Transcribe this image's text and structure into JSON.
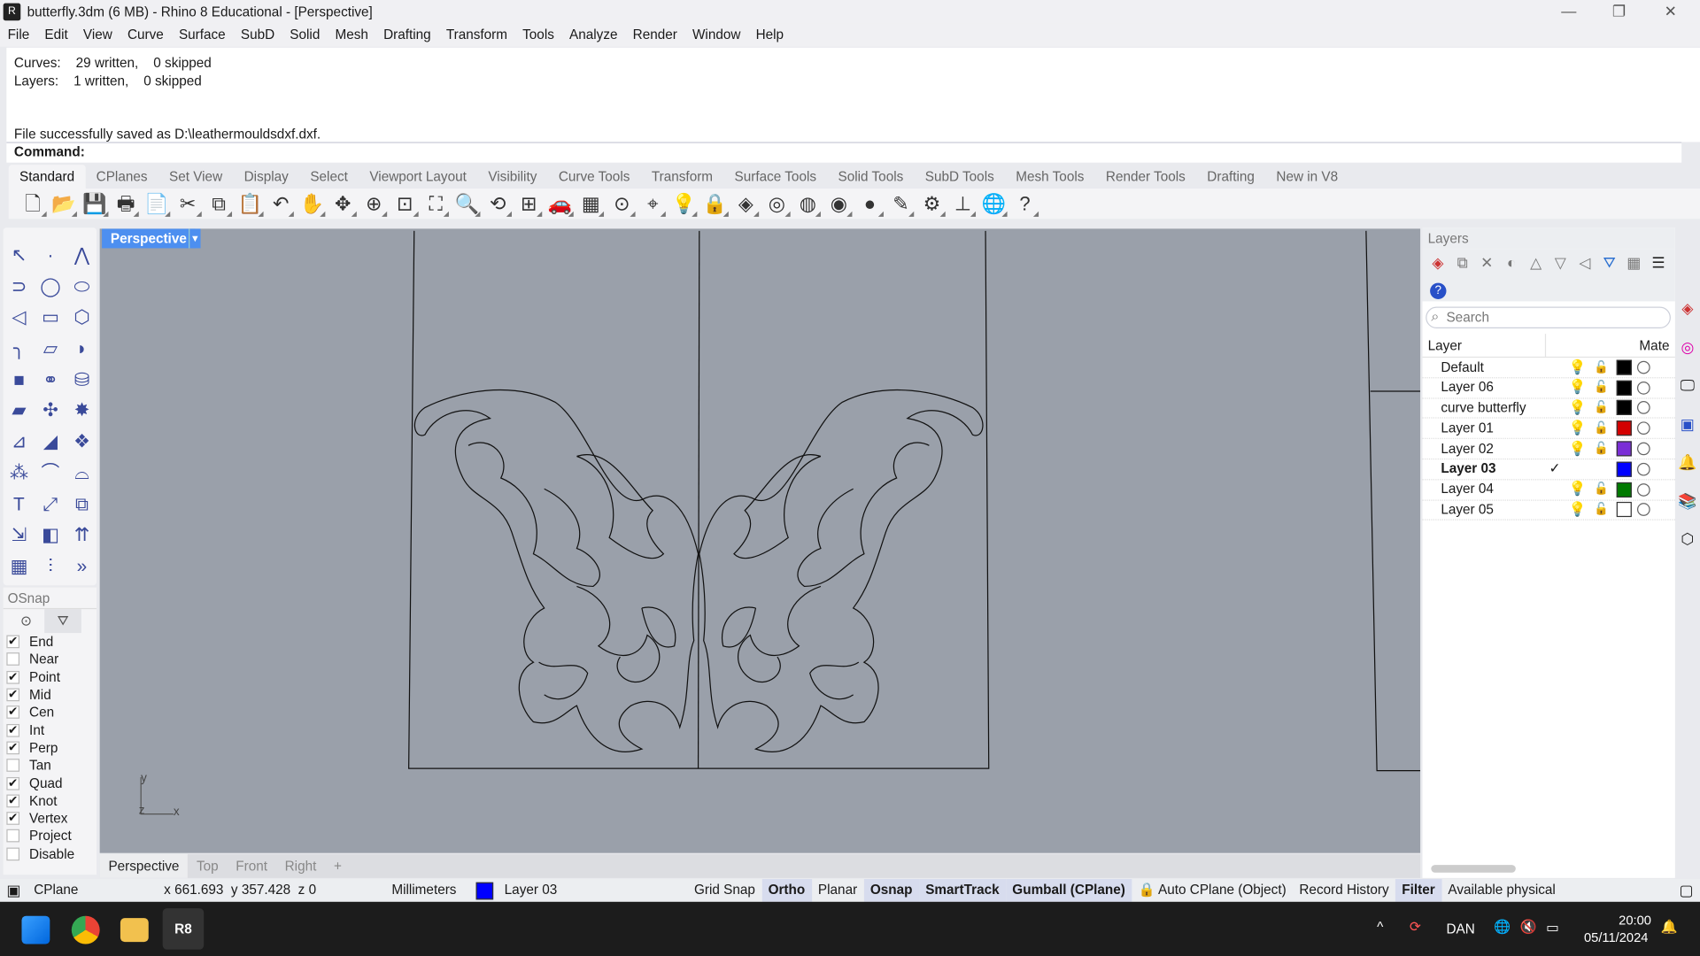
{
  "window": {
    "title": "butterfly.3dm (6 MB) - Rhino 8 Educational - [Perspective]",
    "minimize": "—",
    "restore": "❐",
    "close": "✕"
  },
  "menu": [
    "File",
    "Edit",
    "View",
    "Curve",
    "Surface",
    "SubD",
    "Solid",
    "Mesh",
    "Drafting",
    "Transform",
    "Tools",
    "Analyze",
    "Render",
    "Window",
    "Help"
  ],
  "history": {
    "line1": "Curves:    29 written,    0 skipped",
    "line2": "Layers:    1 written,    0 skipped",
    "line3": "File successfully saved as D:\\leathermouldsdxf.dxf."
  },
  "command": {
    "label": "Command:"
  },
  "toolbar_tabs": [
    "Standard",
    "CPlanes",
    "Set View",
    "Display",
    "Select",
    "Viewport Layout",
    "Visibility",
    "Curve Tools",
    "Transform",
    "Surface Tools",
    "Solid Tools",
    "SubD Tools",
    "Mesh Tools",
    "Render Tools",
    "Drafting",
    "New in V8"
  ],
  "toolbar_icons": [
    {
      "name": "new-icon",
      "g": "🗋"
    },
    {
      "name": "open-icon",
      "g": "📂"
    },
    {
      "name": "save-icon",
      "g": "💾"
    },
    {
      "name": "print-icon",
      "g": "🖶"
    },
    {
      "name": "page-layout-icon",
      "g": "📄"
    },
    {
      "name": "cut-icon",
      "g": "✂"
    },
    {
      "name": "copy-icon",
      "g": "⧉"
    },
    {
      "name": "paste-icon",
      "g": "📋"
    },
    {
      "name": "undo-icon",
      "g": "↶"
    },
    {
      "name": "pan-icon",
      "g": "✋"
    },
    {
      "name": "rotate-view-icon",
      "g": "✥"
    },
    {
      "name": "zoom-icon",
      "g": "⊕"
    },
    {
      "name": "zoom-window-icon",
      "g": "⊡"
    },
    {
      "name": "zoom-extents-icon",
      "g": "⛶"
    },
    {
      "name": "zoom-selected-icon",
      "g": "🔍"
    },
    {
      "name": "undo-view-icon",
      "g": "⟲"
    },
    {
      "name": "four-viewports-icon",
      "g": "⊞"
    },
    {
      "name": "named-views-icon",
      "g": "🚗"
    },
    {
      "name": "grid-icon",
      "g": "▦"
    },
    {
      "name": "cplane-icon",
      "g": "⊙"
    },
    {
      "name": "object-snap-icon",
      "g": "⌖"
    },
    {
      "name": "light-icon",
      "g": "💡"
    },
    {
      "name": "lock-icon",
      "g": "🔒"
    },
    {
      "name": "layers-icon",
      "g": "◈"
    },
    {
      "name": "color-wheel-icon",
      "g": "◎"
    },
    {
      "name": "wireframe-sphere-icon",
      "g": "◍"
    },
    {
      "name": "shaded-icon",
      "g": "◉"
    },
    {
      "name": "render-sphere-icon",
      "g": "●"
    },
    {
      "name": "material-icon",
      "g": "✎"
    },
    {
      "name": "options-icon",
      "g": "⚙"
    },
    {
      "name": "dimension-icon",
      "g": "⊥"
    },
    {
      "name": "globe-icon",
      "g": "🌐"
    },
    {
      "name": "help-icon",
      "g": "?"
    }
  ],
  "left_tools": [
    {
      "name": "select-icon",
      "g": "↖"
    },
    {
      "name": "point-icon",
      "g": "·"
    },
    {
      "name": "polyline-icon",
      "g": "⋀"
    },
    {
      "name": "curve-icon",
      "g": "⊃"
    },
    {
      "name": "circle-icon",
      "g": "◯"
    },
    {
      "name": "ellipse-icon",
      "g": "⬭"
    },
    {
      "name": "arc-icon",
      "g": "◁"
    },
    {
      "name": "rectangle-icon",
      "g": "▭"
    },
    {
      "name": "polygon-icon",
      "g": "⬡"
    },
    {
      "name": "fillet-icon",
      "g": "╮"
    },
    {
      "name": "surface-points-icon",
      "g": "▱"
    },
    {
      "name": "extrude-surface-icon",
      "g": "◗"
    },
    {
      "name": "box-icon",
      "g": "■"
    },
    {
      "name": "boolean-union-icon",
      "g": "⚭"
    },
    {
      "name": "cylinder-icon",
      "g": "⛁"
    },
    {
      "name": "mesh-icon",
      "g": "▰"
    },
    {
      "name": "join-icon",
      "g": "✣"
    },
    {
      "name": "explode-icon",
      "g": "✸"
    },
    {
      "name": "trim-icon",
      "g": "⊿"
    },
    {
      "name": "split-icon",
      "g": "◢"
    },
    {
      "name": "boolean-icon",
      "g": "❖"
    },
    {
      "name": "group-icon",
      "g": "⁂"
    },
    {
      "name": "offset-icon",
      "g": "⌒"
    },
    {
      "name": "blend-icon",
      "g": "⌓"
    },
    {
      "name": "text-icon",
      "g": "T"
    },
    {
      "name": "move-icon",
      "g": "⤢"
    },
    {
      "name": "array-icon",
      "g": "⧉"
    },
    {
      "name": "orient-icon",
      "g": "⇲"
    },
    {
      "name": "solid-edit-icon",
      "g": "◧"
    },
    {
      "name": "project-icon",
      "g": "⇈"
    },
    {
      "name": "grid-array-icon",
      "g": "▦"
    },
    {
      "name": "dimension-icon",
      "g": "⫶"
    },
    {
      "name": "more-icon",
      "g": "»"
    }
  ],
  "osnap": {
    "title": "OSnap",
    "items": [
      {
        "label": "End",
        "checked": true
      },
      {
        "label": "Near",
        "checked": false
      },
      {
        "label": "Point",
        "checked": true
      },
      {
        "label": "Mid",
        "checked": true
      },
      {
        "label": "Cen",
        "checked": true
      },
      {
        "label": "Int",
        "checked": true
      },
      {
        "label": "Perp",
        "checked": true
      },
      {
        "label": "Tan",
        "checked": false
      },
      {
        "label": "Quad",
        "checked": true
      },
      {
        "label": "Knot",
        "checked": true
      },
      {
        "label": "Vertex",
        "checked": true
      },
      {
        "label": "Project",
        "checked": false
      },
      {
        "label": "Disable",
        "checked": false
      }
    ]
  },
  "viewport": {
    "name": "Perspective",
    "axis_y": "y",
    "axis_x": "x",
    "axis_z": "z"
  },
  "viewport_tabs": [
    "Perspective",
    "Top",
    "Front",
    "Right",
    "+"
  ],
  "layers": {
    "title": "Layers",
    "search_placeholder": "Search",
    "col_layer": "Layer",
    "col_material": "Mate",
    "rows": [
      {
        "name": "Default",
        "color": "#000000",
        "current": false
      },
      {
        "name": "Layer 06",
        "color": "#000000",
        "current": false
      },
      {
        "name": "curve butterfly",
        "color": "#000000",
        "current": false
      },
      {
        "name": "Layer 01",
        "color": "#d40000",
        "current": false
      },
      {
        "name": "Layer 02",
        "color": "#7a2ed6",
        "current": false
      },
      {
        "name": "Layer 03",
        "color": "#0000ff",
        "current": true
      },
      {
        "name": "Layer 04",
        "color": "#007a00",
        "current": false
      },
      {
        "name": "Layer 05",
        "color": "#ffffff",
        "current": false
      }
    ]
  },
  "status": {
    "cplane": "CPlane",
    "coords": "x 661.693  y 357.428  z 0",
    "units": "Millimeters",
    "layer": "Layer 03",
    "layer_color": "#0000ff",
    "toggles": [
      {
        "label": "Grid Snap",
        "on": false
      },
      {
        "label": "Ortho",
        "on": true
      },
      {
        "label": "Planar",
        "on": false
      },
      {
        "label": "Osnap",
        "on": true
      },
      {
        "label": "SmartTrack",
        "on": true
      },
      {
        "label": "Gumball (CPlane)",
        "on": true
      },
      {
        "label": "🔒 Auto CPlane (Object)",
        "on": false
      },
      {
        "label": "Record History",
        "on": false
      },
      {
        "label": "Filter",
        "on": true
      },
      {
        "label": "Available physical",
        "on": false
      }
    ]
  },
  "taskbar": {
    "lang": "DAN",
    "time": "20:00",
    "date": "05/11/2024"
  }
}
